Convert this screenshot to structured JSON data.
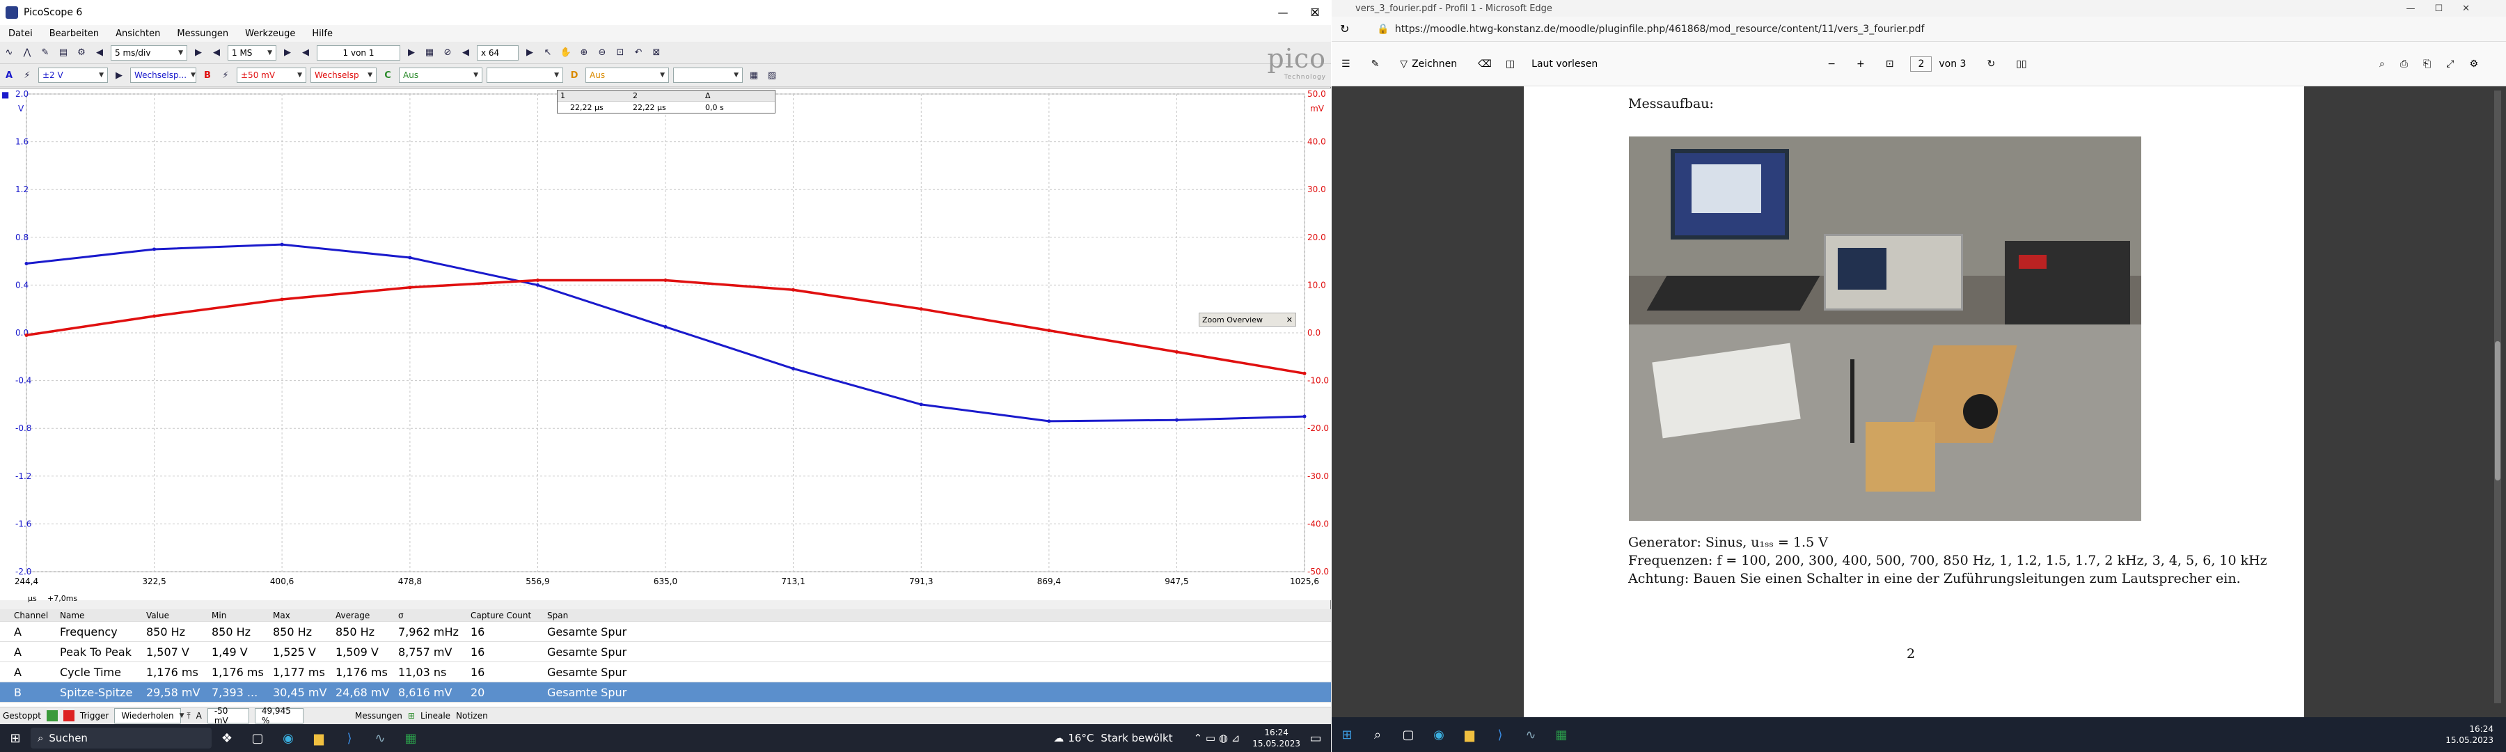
{
  "left_window": {
    "title": "PicoScope 6",
    "window_controls": [
      "—",
      "☐",
      "✕"
    ],
    "menu": [
      "Datei",
      "Bearbeiten",
      "Ansichten",
      "Messungen",
      "Werkzeuge",
      "Hilfe"
    ],
    "toolbar1": {
      "timebase": "5 ms/div",
      "samples": "1 MS",
      "capture": "1 von 1",
      "zoom": "x 64"
    },
    "toolbar2": {
      "chA_range": "±2 V",
      "chA_coupling": "Wechselsp...",
      "chB_range": "±50 mV",
      "chB_coupling": "Wechselsp",
      "chC_label": "Aus",
      "chD_label": "Aus"
    },
    "logo": "pico",
    "logo_sub": "Technology",
    "left_axis_unit": "V",
    "right_axis_unit": "mV",
    "left_axis_ticks": [
      "2.0",
      "1.6",
      "1.2",
      "0.8",
      "0.4",
      "0.0",
      "-0.4",
      "-0.8",
      "-1.2",
      "-1.6",
      "-2.0"
    ],
    "right_axis_ticks": [
      "50.0",
      "40.0",
      "30.0",
      "20.0",
      "10.0",
      "0.0",
      "-10.0",
      "-20.0",
      "-30.0",
      "-40.0",
      "-50.0"
    ],
    "x_ticks": [
      "244,4",
      "322,5",
      "400,6",
      "478,8",
      "556,9",
      "635,0",
      "713,1",
      "791,3",
      "869,4",
      "947,5",
      "1025,6"
    ],
    "x_unit": "µs",
    "x_offset": "+7,0ms",
    "ruler": {
      "headers": [
        "1",
        "2",
        "Δ"
      ],
      "values": [
        "22,22 µs",
        "22,22 µs",
        "0,0 s"
      ]
    },
    "zoom_overview": "Zoom Overview",
    "colors": {
      "channel_a": "#1a1acc",
      "channel_b": "#e01010"
    },
    "chart_data": {
      "type": "line",
      "xlabel": "µs",
      "x": [
        244.4,
        322.5,
        400.6,
        478.8,
        556.9,
        635.0,
        713.1,
        791.3,
        869.4,
        947.5,
        1025.6
      ],
      "series": [
        {
          "name": "A",
          "axis": "left (V)",
          "values": [
            0.58,
            0.7,
            0.74,
            0.63,
            0.4,
            0.05,
            -0.3,
            -0.6,
            -0.74,
            -0.73,
            -0.7
          ]
        },
        {
          "name": "B",
          "axis": "right (mV)",
          "values": [
            -0.5,
            3.5,
            7.0,
            9.5,
            11.0,
            11.0,
            9.0,
            5.0,
            0.5,
            -4.0,
            -8.5
          ]
        }
      ],
      "ylim_left": [
        -2.0,
        2.0
      ],
      "ylim_right": [
        -50.0,
        50.0
      ],
      "xlim": [
        244.4,
        1025.6
      ],
      "grid": true
    },
    "measurements": {
      "headers": [
        "Channel",
        "Name",
        "Value",
        "Min",
        "Max",
        "Average",
        "σ",
        "Capture Count",
        "Span"
      ],
      "rows": [
        [
          "A",
          "Frequency",
          "850 Hz",
          "850 Hz",
          "850 Hz",
          "850 Hz",
          "7,962 mHz",
          "16",
          "Gesamte Spur"
        ],
        [
          "A",
          "Peak To Peak",
          "1,507 V",
          "1,49 V",
          "1,525 V",
          "1,509 V",
          "8,757 mV",
          "16",
          "Gesamte Spur"
        ],
        [
          "A",
          "Cycle Time",
          "1,176 ms",
          "1,176 ms",
          "1,177 ms",
          "1,176 ms",
          "11,03 ns",
          "16",
          "Gesamte Spur"
        ],
        [
          "B",
          "Spitze-Spitze",
          "29,58 mV",
          "7,393 ...",
          "30,45 mV",
          "24,68 mV",
          "8,616 mV",
          "20",
          "Gesamte Spur"
        ]
      ]
    },
    "status": {
      "state": "Gestoppt",
      "trigger": "Trigger",
      "trigger_mode": "Wiederholen",
      "channel": "A",
      "level": "-50 mV",
      "percent": "49,945 %",
      "measurements": "Messungen",
      "rulers": "Lineale",
      "notes": "Notizen"
    }
  },
  "right_window": {
    "title": "vers_3_fourier.pdf - Profil 1 - Microsoft Edge",
    "url": "https://moodle.htwg-konstanz.de/moodle/pluginfile.php/461868/mod_resource/content/11/vers_3_fourier.pdf",
    "pdf_toolbar": {
      "draw": "Zeichnen",
      "read_aloud": "Laut vorlesen",
      "page": "2",
      "page_of": "von 3"
    },
    "page": {
      "heading": "Messaufbau:",
      "line1": "Generator: Sinus, u₁ₛₛ = 1.5 V",
      "line2": "Frequenzen: f = 100, 200, 300, 400, 500, 700, 850 Hz, 1, 1.2, 1.5, 1.7, 2 kHz, 3, 4, 5, 6, 10 kHz",
      "line3": "Achtung: Bauen Sie einen Schalter in eine der Zuführungsleitungen zum Lautsprecher ein.",
      "page_number": "2"
    }
  },
  "taskbar_left": {
    "search": "Suchen",
    "weather_temp": "16°C",
    "weather_text": "Stark bewölkt",
    "time": "16:24",
    "date": "15.05.2023"
  },
  "taskbar_right": {
    "time": "16:24",
    "date": "15.05.2023"
  }
}
